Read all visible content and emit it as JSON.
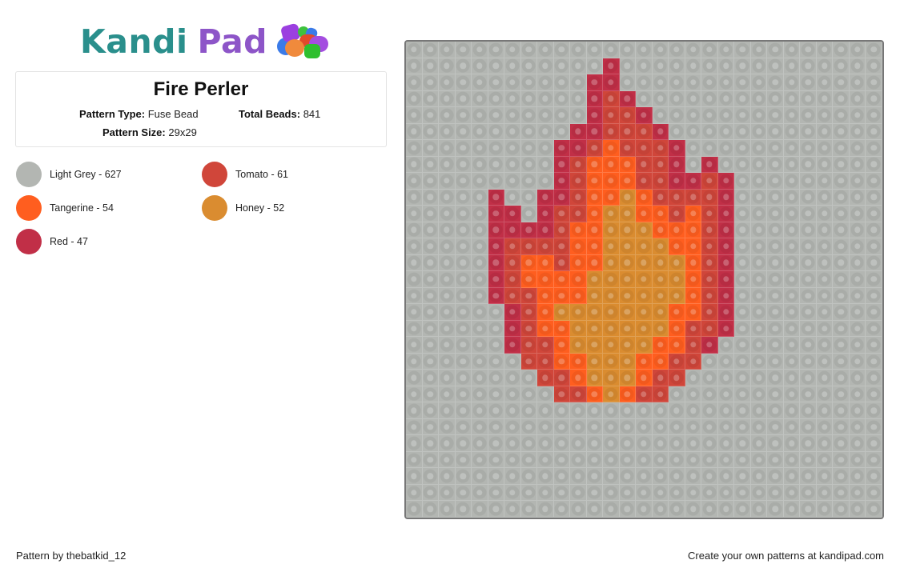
{
  "logo": {
    "part1": "Kandi",
    "part2": "Pad",
    "icon": "bead-pile-icon"
  },
  "pattern": {
    "title": "Fire Perler",
    "type_label": "Pattern Type:",
    "type_value": "Fuse Bead",
    "beads_label": "Total Beads:",
    "beads_value": "841",
    "size_label": "Pattern Size:",
    "size_value": "29x29"
  },
  "legend": [
    {
      "key": "G",
      "name": "Light Grey",
      "count": 627,
      "label": "Light Grey - 627",
      "color": "#b3b6b2"
    },
    {
      "key": "T",
      "name": "Tomato",
      "count": 61,
      "label": "Tomato - 61",
      "color": "#d0463a"
    },
    {
      "key": "O",
      "name": "Tangerine",
      "count": 54,
      "label": "Tangerine - 54",
      "color": "#ff5e1f"
    },
    {
      "key": "H",
      "name": "Honey",
      "count": 52,
      "label": "Honey - 52",
      "color": "#da8c30"
    },
    {
      "key": "R",
      "name": "Red",
      "count": 47,
      "label": "Red - 47",
      "color": "#c12f47"
    }
  ],
  "grid": {
    "columns": 29,
    "rows": 29,
    "cells": [
      "GGGGGGGGGGGGGGGGGGGGGGGGGGGGG",
      "GGGGGGGGGGGGRGGGGGGGGGGGGGGGG",
      "GGGGGGGGGGGRRGGGGGGGGGGGGGGGG",
      "GGGGGGGGGGGRTRGGGGGGGGGGGGGGG",
      "GGGGGGGGGGGRTTRGGGGGGGGGGGGGG",
      "GGGGGGGGGGRRTTTRGGGGGGGGGGGGG",
      "GGGGGGGGGRRTOTTTRGGGGGGGGGGGG",
      "GGGGGGGGGRTOOOTTRGRGGGGGGGGGG",
      "GGGGGGGGGRTOOOTTRRTRGGGGGGGGG",
      "GGGGGRGGRRTOOHOTTTTRGGGGGGGGG",
      "GGGGGRRGRTTOHHOOTOTRGGGGGGGGG",
      "GGGGGRRRRTOOHHHOOOTRGGGGGGGGG",
      "GGGGGRTTTTOOHHHHOOTRGGGGGGGGG",
      "GGGGGRTOOTOOHHHHHOTRGGGGGGGGG",
      "GGGGGRTOOOOHHHHHHOTRGGGGGGGGG",
      "GGGGGRTTOOOHHHHHHOTRGGGGGGGGG",
      "GGGGGGRTOHHHHHHHOOTRGGGGGGGGG",
      "GGGGGGRTOOHHHHHHOTTRGGGGGGGGG",
      "GGGGGGRTTOHHHHHOOTRGGGGGGGGGG",
      "GGGGGGGTTOOHHHOOTTGGGGGGGGGGG",
      "GGGGGGGGTTOHHHOTTGGGGGGGGGGGG",
      "GGGGGGGGGTTOHOTTGGGGGGGGGGGGG",
      "GGGGGGGGGGGGGGGGGGGGGGGGGGGGG",
      "GGGGGGGGGGGGGGGGGGGGGGGGGGGGG",
      "GGGGGGGGGGGGGGGGGGGGGGGGGGGGG",
      "GGGGGGGGGGGGGGGGGGGGGGGGGGGGG",
      "GGGGGGGGGGGGGGGGGGGGGGGGGGGGG",
      "GGGGGGGGGGGGGGGGGGGGGGGGGGGGG",
      "GGGGGGGGGGGGGGGGGGGGGGGGGGGGG"
    ]
  },
  "footer": {
    "credit": "Pattern by thebatkid_12",
    "promo": "Create your own patterns at kandipad.com"
  }
}
